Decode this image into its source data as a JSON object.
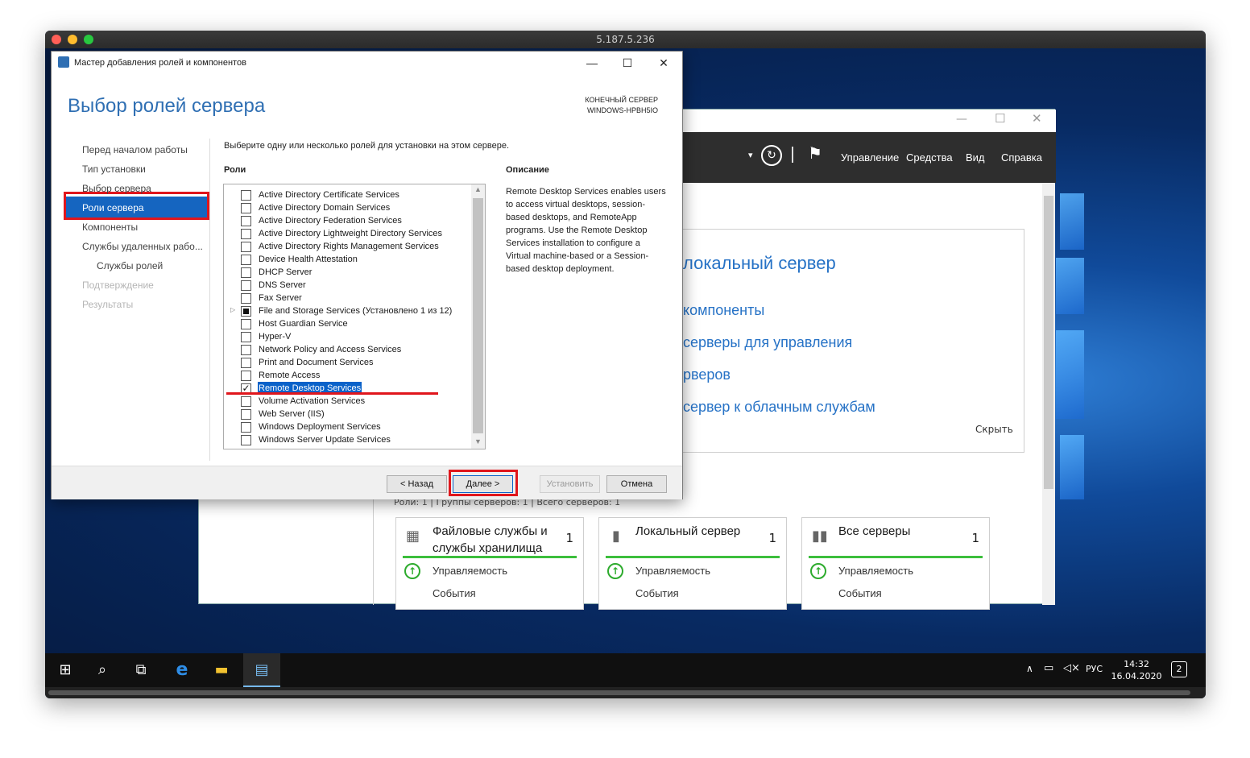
{
  "mac_window": {
    "title": "5.187.5.236"
  },
  "server_manager": {
    "menu": {
      "manage": "Управление",
      "tools": "Средства",
      "view": "Вид",
      "help": "Справка"
    },
    "links": {
      "local_server": "локальный сервер",
      "components": "компоненты",
      "servers_to_manage": "серверы для управления",
      "servers": "рверов",
      "cloud": "сервер к облачным службам"
    },
    "hide": "Скрыть",
    "summary": "Роли: 1 | Группы серверов: 1 | Всего серверов: 1",
    "tiles": [
      {
        "title": "Файловые службы и службы хранилища",
        "count": "1",
        "manageability": "Управляемость",
        "events": "События"
      },
      {
        "title": "Локальный сервер",
        "count": "1",
        "manageability": "Управляемость",
        "events": "События"
      },
      {
        "title": "Все серверы",
        "count": "1",
        "manageability": "Управляемость",
        "events": "События"
      }
    ]
  },
  "wizard": {
    "title": "Мастер добавления ролей и компонентов",
    "heading": "Выбор ролей сервера",
    "destination_label": "КОНЕЧНЫЙ СЕРВЕР",
    "destination_name": "WINDOWS-HPBH5IO",
    "nav": [
      {
        "label": "Перед началом работы",
        "state": "normal"
      },
      {
        "label": "Тип установки",
        "state": "normal"
      },
      {
        "label": "Выбор сервера",
        "state": "normal"
      },
      {
        "label": "Роли сервера",
        "state": "active"
      },
      {
        "label": "Компоненты",
        "state": "normal"
      },
      {
        "label": "Службы удаленных рабо...",
        "state": "normal"
      },
      {
        "label": "Службы ролей",
        "state": "sub"
      },
      {
        "label": "Подтверждение",
        "state": "disabled"
      },
      {
        "label": "Результаты",
        "state": "disabled"
      }
    ],
    "intro": "Выберите одну или несколько ролей для установки на этом сервере.",
    "roles_header": "Роли",
    "description_header": "Описание",
    "description": "Remote Desktop Services enables users to access virtual desktops, session-based desktops, and RemoteApp programs. Use the Remote Desktop Services installation to configure a Virtual machine-based or a Session-based desktop deployment.",
    "roles": [
      {
        "label": "Active Directory Certificate Services",
        "state": "unchecked"
      },
      {
        "label": "Active Directory Domain Services",
        "state": "unchecked"
      },
      {
        "label": "Active Directory Federation Services",
        "state": "unchecked"
      },
      {
        "label": "Active Directory Lightweight Directory Services",
        "state": "unchecked"
      },
      {
        "label": "Active Directory Rights Management Services",
        "state": "unchecked"
      },
      {
        "label": "Device Health Attestation",
        "state": "unchecked"
      },
      {
        "label": "DHCP Server",
        "state": "unchecked"
      },
      {
        "label": "DNS Server",
        "state": "unchecked"
      },
      {
        "label": "Fax Server",
        "state": "unchecked"
      },
      {
        "label": "File and Storage Services (Установлено 1 из 12)",
        "state": "partial"
      },
      {
        "label": "Host Guardian Service",
        "state": "unchecked"
      },
      {
        "label": "Hyper-V",
        "state": "unchecked"
      },
      {
        "label": "Network Policy and Access Services",
        "state": "unchecked"
      },
      {
        "label": "Print and Document Services",
        "state": "unchecked"
      },
      {
        "label": "Remote Access",
        "state": "unchecked"
      },
      {
        "label": "Remote Desktop Services",
        "state": "checked"
      },
      {
        "label": "Volume Activation Services",
        "state": "unchecked"
      },
      {
        "label": "Web Server (IIS)",
        "state": "unchecked"
      },
      {
        "label": "Windows Deployment Services",
        "state": "unchecked"
      },
      {
        "label": "Windows Server Update Services",
        "state": "unchecked"
      }
    ],
    "buttons": {
      "back": "< Назад",
      "next": "Далее >",
      "install": "Установить",
      "cancel": "Отмена"
    }
  },
  "taskbar": {
    "language": "РУС",
    "time": "14:32",
    "date": "16.04.2020",
    "notifications": "2"
  },
  "colors": {
    "accent": "#1565c0",
    "highlight": "#e0161c",
    "link": "#2672c6",
    "ok": "#3cbf3c"
  }
}
